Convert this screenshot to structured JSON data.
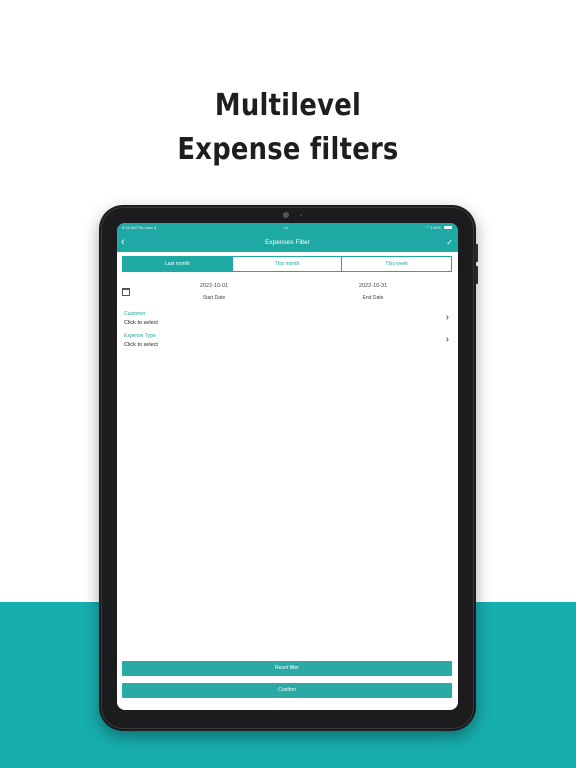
{
  "headline": {
    "line1": "Multilevel",
    "line2": "Expense filters"
  },
  "statusbar": {
    "time": "9:24 AM  Thu Nov 3",
    "center": "•••",
    "battery": "100%"
  },
  "navbar": {
    "back_icon": "chevron-left-icon",
    "title": "Expenses Filter",
    "check_icon": "checkmark-icon",
    "back_glyph": "‹",
    "check_glyph": "✓"
  },
  "segments": {
    "items": [
      "Last month",
      "This month",
      "This week"
    ],
    "selected": "Last month"
  },
  "dates": {
    "start_value": "2022-10-01",
    "start_label": "Start Date",
    "end_value": "2022-10-31",
    "end_label": "End Date"
  },
  "fields": {
    "customer": {
      "label": "Customer",
      "value": "Click to select"
    },
    "expense_type": {
      "label": "Expense Type",
      "value": "Click to select"
    }
  },
  "chevron_glyph": "›",
  "buttons": {
    "reset": "Reset filter",
    "confirm": "Confirm"
  },
  "colors": {
    "accent": "#1fa9a5",
    "background_band": "#17aeb0",
    "device": "#1c1c1e"
  }
}
